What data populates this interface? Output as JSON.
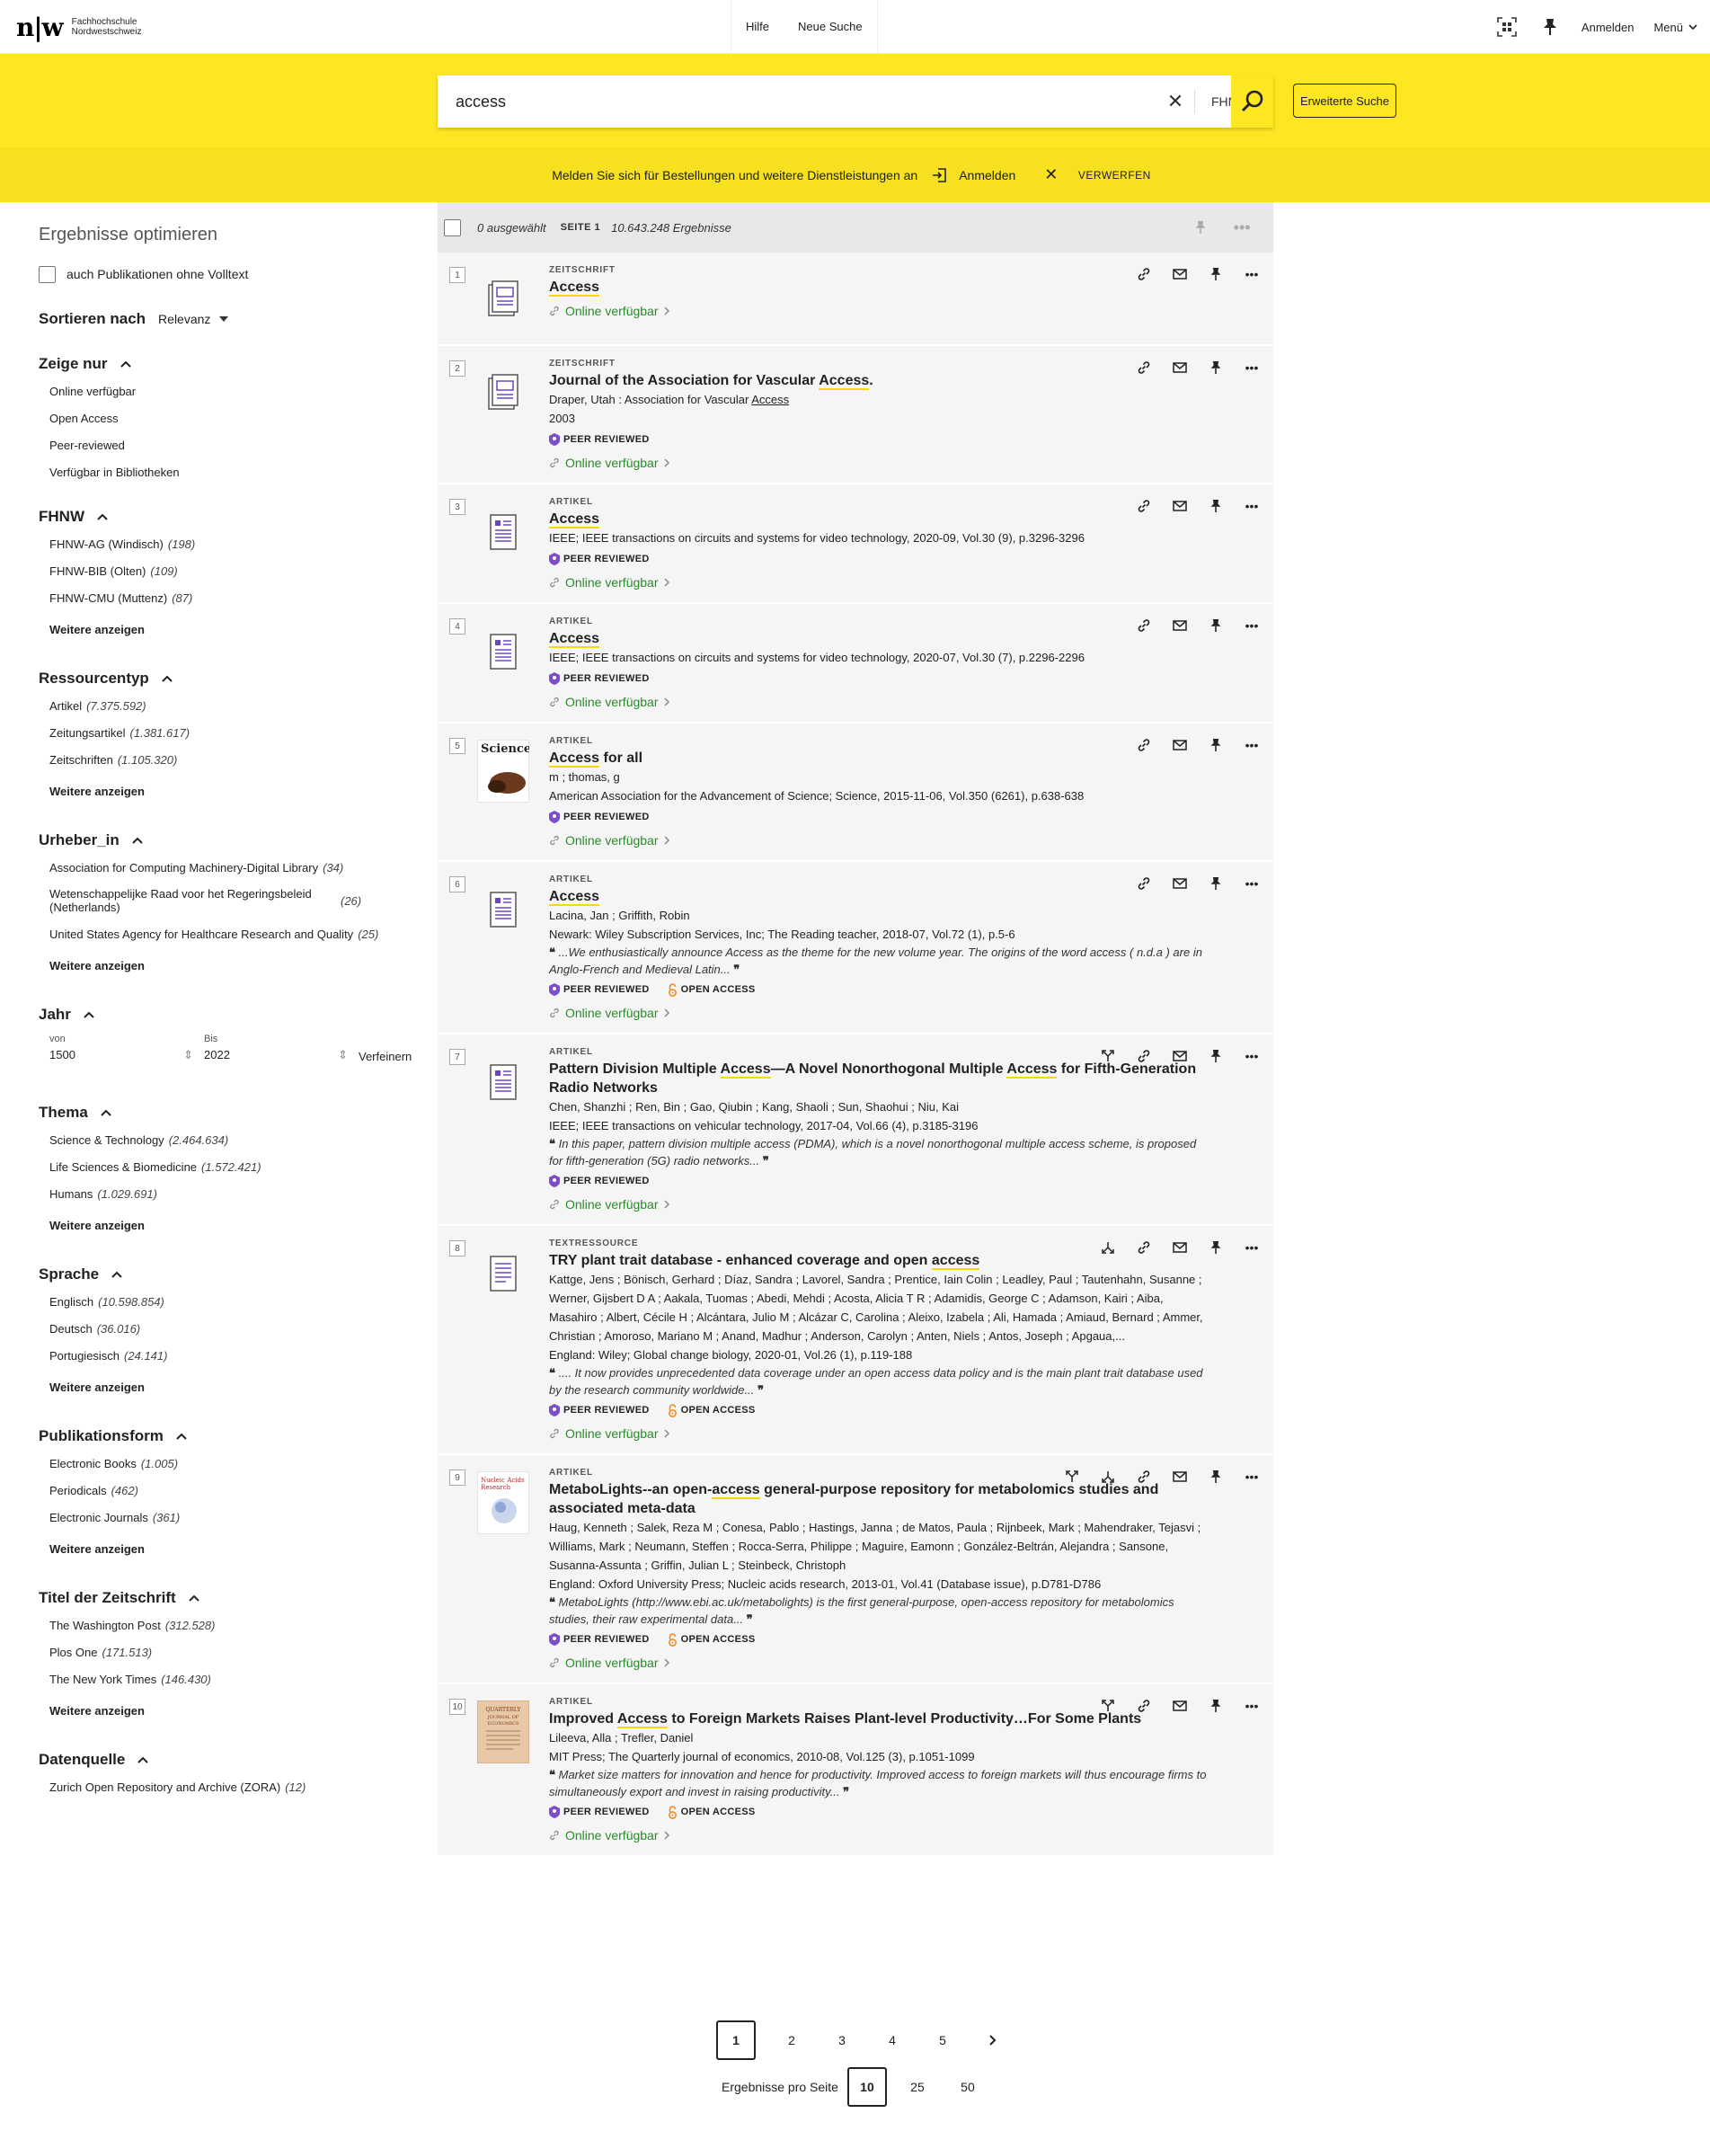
{
  "header": {
    "logo_mark": "n|w",
    "logo_line1": "Fachhochschule",
    "logo_line2": "Nordwestschweiz",
    "nav": [
      "Hilfe",
      "Neue Suche"
    ],
    "signin": "Anmelden",
    "menu": "Menü"
  },
  "search": {
    "value": "access",
    "scope": "FHNW",
    "advanced": "Erweiterte Suche"
  },
  "banner": {
    "text": "Melden Sie sich für Bestellungen und weitere Dienstleistungen an",
    "signin": "Anmelden",
    "dismiss": "VERWERFEN"
  },
  "sidebar": {
    "title": "Ergebnisse optimieren",
    "fulltext_label": "auch Publikationen ohne Volltext",
    "sort_label": "Sortieren nach",
    "sort_value": "Relevanz",
    "show_only": {
      "title": "Zeige nur",
      "items": [
        "Online verfügbar",
        "Open Access",
        "Peer-reviewed",
        "Verfügbar in Bibliotheken"
      ]
    },
    "fhnw": {
      "title": "FHNW",
      "items": [
        {
          "label": "FHNW-AG (Windisch)",
          "count": "(198)"
        },
        {
          "label": "FHNW-BIB (Olten)",
          "count": "(109)"
        },
        {
          "label": "FHNW-CMU (Muttenz)",
          "count": "(87)"
        }
      ]
    },
    "ressourcentyp": {
      "title": "Ressourcentyp",
      "items": [
        {
          "label": "Artikel",
          "count": "(7.375.592)"
        },
        {
          "label": "Zeitungsartikel",
          "count": "(1.381.617)"
        },
        {
          "label": "Zeitschriften",
          "count": "(1.105.320)"
        }
      ]
    },
    "urheber": {
      "title": "Urheber_in",
      "items": [
        {
          "label": "Association for Computing Machinery-Digital Library",
          "count": "(34)"
        },
        {
          "label": "Wetenschappelijke Raad voor het Regeringsbeleid (Netherlands)",
          "count": "(26)"
        },
        {
          "label": "United States Agency for Healthcare Research and Quality",
          "count": "(25)"
        }
      ]
    },
    "jahr": {
      "title": "Jahr",
      "von_label": "von",
      "von": "1500",
      "bis_label": "Bis",
      "bis": "2022",
      "refine": "Verfeinern"
    },
    "thema": {
      "title": "Thema",
      "items": [
        {
          "label": "Science & Technology",
          "count": "(2.464.634)"
        },
        {
          "label": "Life Sciences & Biomedicine",
          "count": "(1.572.421)"
        },
        {
          "label": "Humans",
          "count": "(1.029.691)"
        }
      ]
    },
    "sprache": {
      "title": "Sprache",
      "items": [
        {
          "label": "Englisch",
          "count": "(10.598.854)"
        },
        {
          "label": "Deutsch",
          "count": "(36.016)"
        },
        {
          "label": "Portugiesisch",
          "count": "(24.141)"
        }
      ]
    },
    "publikationsform": {
      "title": "Publikationsform",
      "items": [
        {
          "label": "Electronic Books",
          "count": "(1.005)"
        },
        {
          "label": "Periodicals",
          "count": "(462)"
        },
        {
          "label": "Electronic Journals",
          "count": "(361)"
        }
      ]
    },
    "zeitschrift": {
      "title": "Titel der Zeitschrift",
      "items": [
        {
          "label": "The Washington Post",
          "count": "(312.528)"
        },
        {
          "label": "Plos One",
          "count": "(171.513)"
        },
        {
          "label": "The New York Times",
          "count": "(146.430)"
        }
      ]
    },
    "datenquelle": {
      "title": "Datenquelle",
      "items": [
        {
          "label": "Zurich Open Repository and Archive (ZORA)",
          "count": "(12)"
        }
      ]
    },
    "more": "Weitere anzeigen"
  },
  "results": {
    "selected": "0 ausgewählt",
    "page": "SEITE 1",
    "total": "10.643.248 Ergebnisse",
    "peer": "PEER REVIEWED",
    "oa": "OPEN ACCESS",
    "avail": "Online verfügbar",
    "items": [
      {
        "n": "1",
        "type": "ZEITSCHRIFT",
        "title": "Access",
        "lines": [],
        "quote": ""
      },
      {
        "n": "2",
        "type": "ZEITSCHRIFT",
        "title": "Journal of the Association for Vascular Access.",
        "lines": [
          "Draper, Utah : Association for Vascular Access",
          "2003"
        ],
        "quote": ""
      },
      {
        "n": "3",
        "type": "ARTIKEL",
        "title": "Access",
        "lines": [
          "IEEE; IEEE transactions on circuits and systems for video technology, 2020-09, Vol.30 (9), p.3296-3296"
        ],
        "quote": ""
      },
      {
        "n": "4",
        "type": "ARTIKEL",
        "title": "Access",
        "lines": [
          "IEEE; IEEE transactions on circuits and systems for video technology, 2020-07, Vol.30 (7), p.2296-2296"
        ],
        "quote": ""
      },
      {
        "n": "5",
        "type": "ARTIKEL",
        "title": "Access for all",
        "lines": [
          "m ; thomas, g",
          "American Association for the Advancement of Science; Science, 2015-11-06, Vol.350 (6261), p.638-638"
        ],
        "quote": ""
      },
      {
        "n": "6",
        "type": "ARTIKEL",
        "title": "Access",
        "lines": [
          "Lacina, Jan ; Griffith, Robin",
          "Newark: Wiley Subscription Services, Inc; The Reading teacher, 2018-07, Vol.72 (1), p.5-6"
        ],
        "quote": "...We enthusiastically announce Access as the theme for the new volume year. The origins of the word access ( n.d.a ) are in Anglo-French and Medieval Latin..."
      },
      {
        "n": "7",
        "type": "ARTIKEL",
        "title": "Pattern Division Multiple Access—A Novel Nonorthogonal Multiple Access for Fifth-Generation Radio Networks",
        "lines": [
          "Chen, Shanzhi ; Ren, Bin ; Gao, Qiubin ; Kang, Shaoli ; Sun, Shaohui ; Niu, Kai",
          "IEEE; IEEE transactions on vehicular technology, 2017-04, Vol.66 (4), p.3185-3196"
        ],
        "quote": "In this paper, pattern division multiple access (PDMA), which is a novel nonorthogonal multiple access scheme, is proposed for fifth-generation (5G) radio networks..."
      },
      {
        "n": "8",
        "type": "TEXTRESSOURCE",
        "title": "TRY plant trait database - enhanced coverage and open access",
        "lines": [
          "Kattge, Jens ; Bönisch, Gerhard ; Díaz, Sandra ; Lavorel, Sandra ; Prentice, Iain Colin ; Leadley, Paul ; Tautenhahn, Susanne ; Werner, Gijsbert D A ; Aakala, Tuomas ; Abedi, Mehdi ; Acosta, Alicia T R ; Adamidis, George C ; Adamson, Kairi ; Aiba, Masahiro ; Albert, Cécile H ; Alcántara, Julio M ; Alcázar C, Carolina ; Aleixo, Izabela ; Ali, Hamada ; Amiaud, Bernard ; Ammer, Christian ; Amoroso, Mariano M ; Anand, Madhur ; Anderson, Carolyn ; Anten, Niels ; Antos, Joseph ; Apgaua,...",
          "England: Wiley; Global change biology, 2020-01, Vol.26 (1), p.119-188"
        ],
        "quote": ".... It now provides unprecedented data coverage under an open access data policy and is the main plant trait database used by the research community worldwide..."
      },
      {
        "n": "9",
        "type": "ARTIKEL",
        "title": "MetaboLights--an open-access general-purpose repository for metabolomics studies and associated meta-data",
        "lines": [
          "Haug, Kenneth ; Salek, Reza M ; Conesa, Pablo ; Hastings, Janna ; de Matos, Paula ; Rijnbeek, Mark ; Mahendraker, Tejasvi ; Williams, Mark ; Neumann, Steffen ; Rocca-Serra, Philippe ; Maguire, Eamonn ; González-Beltrán, Alejandra ; Sansone, Susanna-Assunta ; Griffin, Julian L ; Steinbeck, Christoph",
          "England: Oxford University Press; Nucleic acids research, 2013-01, Vol.41 (Database issue), p.D781-D786"
        ],
        "quote": "MetaboLights (http://www.ebi.ac.uk/metabolights) is the first general-purpose, open-access repository for metabolomics studies, their raw experimental data..."
      },
      {
        "n": "10",
        "type": "ARTIKEL",
        "title": "Improved Access to Foreign Markets Raises Plant-level Productivity…For Some Plants",
        "lines": [
          "Lileeva, Alla ; Trefler, Daniel",
          "MIT Press; The Quarterly journal of economics, 2010-08, Vol.125 (3), p.1051-1099"
        ],
        "quote": "Market size matters for innovation and hence for productivity. Improved access to foreign markets will thus encourage firms to simultaneously export and invest in raising productivity..."
      }
    ]
  },
  "pagination": {
    "pages": [
      "1",
      "2",
      "3",
      "4",
      "5"
    ],
    "per_page_label": "Ergebnisse pro Seite",
    "per_page": [
      "10",
      "25",
      "50"
    ]
  }
}
